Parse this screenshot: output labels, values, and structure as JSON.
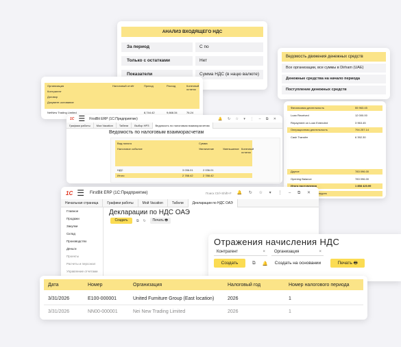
{
  "vat_analysis": {
    "title": "АНАЛИЗ ВХОДЯЩЕГО НДС",
    "fields": [
      {
        "label": "За период",
        "value": "С по"
      },
      {
        "label": "Только с остатками",
        "value": "Нет"
      },
      {
        "label": "Показатели",
        "value": "Сумма НДС (в нацю валюте)"
      }
    ]
  },
  "cash_flow": {
    "title": "Ведомость движения денежных средств",
    "items": [
      "Все организации, все суммы в Dirham (UAE)",
      "Денежные средства на начало периода",
      "Поступление денежных средств"
    ]
  },
  "mini_sheet": {
    "headers": [
      "Организация",
      "Налоговый отчёт",
      "Приход",
      "Расход",
      "Конечный остаток"
    ],
    "subrows": [
      "Контрагент",
      "Договор",
      "Документ-основание"
    ],
    "row": [
      "NetNew Trading Limited",
      "",
      "8,744.42",
      "9,668.34",
      "76.24"
    ]
  },
  "right_numbers": {
    "rows": [
      {
        "label": "Финансовая деятельность",
        "value": "55 963.45"
      },
      {
        "label": "Loan Received",
        "value": "12 000.00"
      },
      {
        "label": "Repayment on Loan Extended",
        "value": "3 963.45"
      },
      {
        "label": "Операционная деятельность",
        "value": "794 257.14"
      },
      {
        "label": "Cash Transfer",
        "value": "6 392.30"
      },
      {
        "label": "Другое",
        "value": "783 096.00"
      },
      {
        "label": "Opening Balance",
        "value": "783 096.00"
      },
      {
        "label": "Итого поступления",
        "value": "1 858 420.99"
      },
      {
        "label": "Выбытие денежных средств",
        "value": ""
      }
    ]
  },
  "mutual": {
    "app_title": "FirstBit ERP (1С:Предприятие)",
    "tabs": [
      "Графики работы",
      "Мои Vacation",
      "Табели",
      "Выбор НРЗ",
      "Ведомость по налоговым взаиморасчетам"
    ],
    "title": "Ведомость по налоговым взаиморасчетам",
    "headers": [
      "Вид налога",
      "Налоговое событие",
      "Сумма",
      "Увеличение",
      "Уменьшение",
      "Конечный остаток"
    ],
    "rows": [
      [
        "НДС",
        "",
        "3 036.01",
        "2 036.01",
        ""
      ],
      [
        "Итого",
        "",
        "2 788.42",
        "2 788.42",
        ""
      ]
    ]
  },
  "erp": {
    "app_title": "FirstBit ERP (1С:Предприятие)",
    "search_placeholder": "Поиск Ctrl+Shift+F",
    "tabs": [
      "Начальная страница",
      "Графики работы",
      "Мой Vacation",
      "Табели",
      "Декларации по НДС ОАЭ"
    ],
    "sidebar": [
      "Главное",
      "Продажи",
      "Закупки",
      "Склад",
      "Производство",
      "Деньги",
      "Проекты",
      "Расчеты и персонал",
      "Управление отчетами"
    ],
    "title": "Декларации по НДС ОАЭ",
    "create_label": "Создать",
    "print_label": "Печать"
  },
  "vat_reflections": {
    "title": "Отражения начисления НДС",
    "counterparty_label": "Контрагент",
    "organization_label": "Организация",
    "create_label": "Создать",
    "create_based_label": "Создать на основании",
    "print_label": "Печать"
  },
  "declarations_table": {
    "headers": [
      "Дата",
      "Номер",
      "Организация",
      "Налоговый год",
      "Номер налогового периода"
    ],
    "rows": [
      [
        "3/31/2026",
        "E100-000001",
        "United Furniture Group (East location)",
        "2026",
        "1"
      ],
      [
        "3/31/2026",
        "NN00-000001",
        "Nei New Trading Limited",
        "2026",
        "1"
      ]
    ]
  },
  "colors": {
    "accent_yellow": "#fbe488",
    "button_yellow": "#fbdc53",
    "logo_red": "#e0321c"
  }
}
